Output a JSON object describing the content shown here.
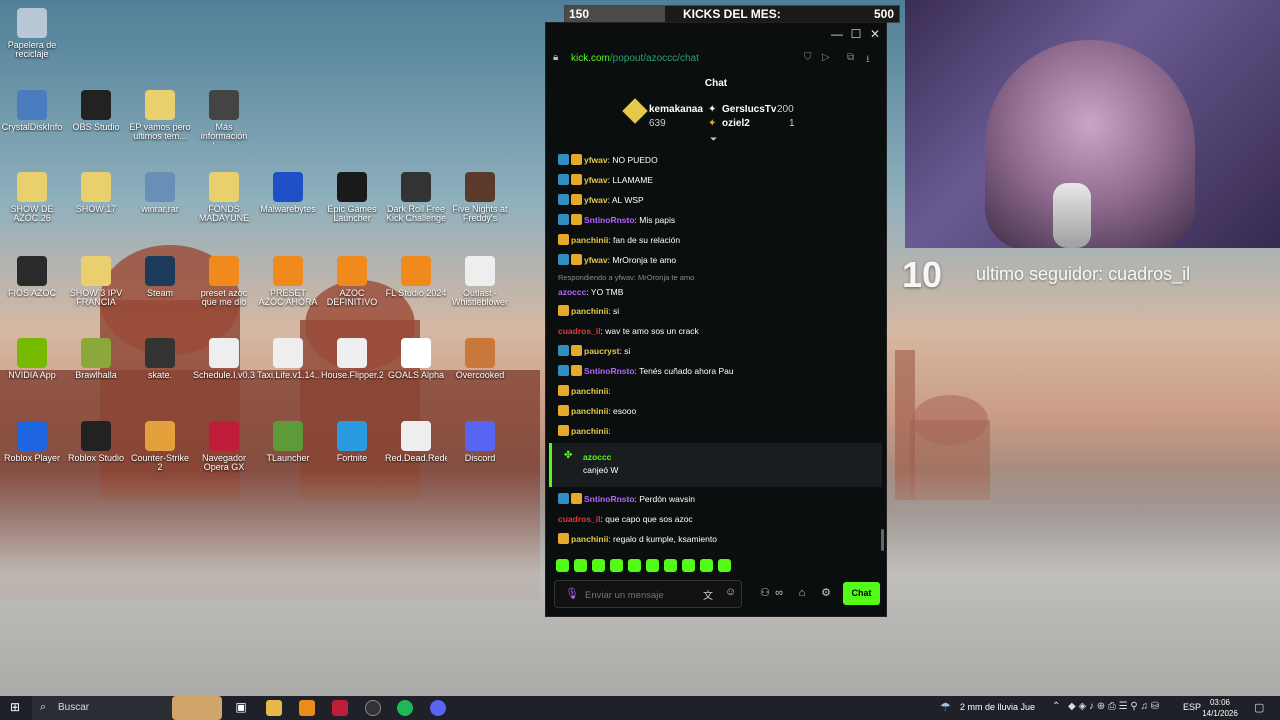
{
  "desktop": {
    "icons": [
      {
        "label": "Papelera de reciclaje",
        "icon": "recycle-bin-icon",
        "color": "#b8c6d6"
      },
      {
        "label": "CrystalDiskInfo",
        "icon": "disk-icon",
        "color": "#4a7cc0"
      },
      {
        "label": "OBS Studio",
        "icon": "obs-icon",
        "color": "#222222"
      },
      {
        "label": "EP vamos pero ultimos tem...",
        "icon": "folder-icon",
        "color": "#e9cf6d"
      },
      {
        "label": "Más información sobre esta ima...",
        "icon": "camera-icon",
        "color": "#444444"
      },
      {
        "label": "SHOW DE AZOC 26",
        "icon": "folder-icon",
        "color": "#e9cf6d"
      },
      {
        "label": "SHOW 17",
        "icon": "folder-icon",
        "color": "#e9cf6d"
      },
      {
        "label": "winrar.rar",
        "icon": "archive-icon",
        "color": "#6a8fb6"
      },
      {
        "label": "FONDS MADAYUNE",
        "icon": "folder-icon",
        "color": "#e9cf6d"
      },
      {
        "label": "Malwarebytes",
        "icon": "malwarebytes-icon",
        "color": "#2050c8"
      },
      {
        "label": "Epic Games Launcher",
        "icon": "epic-icon",
        "color": "#1a1a1a"
      },
      {
        "label": "Dark Roll Free Kick Challenge",
        "icon": "ball-icon",
        "color": "#333333"
      },
      {
        "label": "Five Nights at Freddy's",
        "icon": "freddy-icon",
        "color": "#5a3a2a"
      },
      {
        "label": "FIOS AZOC",
        "icon": "folder-icon",
        "color": "#2a2a2a"
      },
      {
        "label": "SHOW 3 IPV FRANCIA",
        "icon": "folder-icon",
        "color": "#e9cf6d"
      },
      {
        "label": "Steam",
        "icon": "steam-icon",
        "color": "#1b3a5c"
      },
      {
        "label": "preset azoc que me dio gonza",
        "icon": "fl-icon",
        "color": "#f08a1c"
      },
      {
        "label": "PRESET AZOC AHORA SI",
        "icon": "fl-icon",
        "color": "#f08a1c"
      },
      {
        "label": "AZOC DEFINITIVO",
        "icon": "fl-icon",
        "color": "#f08a1c"
      },
      {
        "label": "FL Studio 2024",
        "icon": "fl-icon",
        "color": "#f08a1c"
      },
      {
        "label": "Outlast - Whistleblower",
        "icon": "file-icon",
        "color": "#eeeeee"
      },
      {
        "label": "NVIDIA App",
        "icon": "nvidia-icon",
        "color": "#76b900"
      },
      {
        "label": "Brawlhalla",
        "icon": "brawlhalla-icon",
        "color": "#8ba83a"
      },
      {
        "label": "skate.",
        "icon": "skate-icon",
        "color": "#333333"
      },
      {
        "label": "Schedule.I.v0.3...",
        "icon": "file-icon",
        "color": "#eeeeee"
      },
      {
        "label": "Taxi.Life.v1.14...",
        "icon": "file-icon",
        "color": "#eeeeee"
      },
      {
        "label": "House.Flipper.2...",
        "icon": "file-icon",
        "color": "#eeeeee"
      },
      {
        "label": "GOALS Alpha",
        "icon": "goals-icon",
        "color": "#ffffff"
      },
      {
        "label": "Overcooked",
        "icon": "overcooked-icon",
        "color": "#c9773a"
      },
      {
        "label": "Roblox Player",
        "icon": "roblox-icon",
        "color": "#1f64e0"
      },
      {
        "label": "Roblox Studio",
        "icon": "roblox-studio-icon",
        "color": "#222222"
      },
      {
        "label": "Counter-Strike 2",
        "icon": "cs2-icon",
        "color": "#e4a03a"
      },
      {
        "label": "Navegador Opera GX",
        "icon": "opera-icon",
        "color": "#c01d3a"
      },
      {
        "label": "TLauncher",
        "icon": "minecraft-icon",
        "color": "#5c9a3a"
      },
      {
        "label": "Fortnite",
        "icon": "fortnite-icon",
        "color": "#2b9be0"
      },
      {
        "label": "Red.Dead.Rede...",
        "icon": "file-icon",
        "color": "#eeeeee"
      },
      {
        "label": "Discord",
        "icon": "discord-icon",
        "color": "#5865f2"
      }
    ]
  },
  "kicks_bar": {
    "current": "150",
    "label": "KICKS DEL MES:",
    "goal": "500",
    "progress": 0.3
  },
  "chat": {
    "url_host": "kick.com",
    "url_path": "/popout/azoccc/chat",
    "title": "Chat",
    "leaders": [
      {
        "name": "kemakanaa",
        "count": "639",
        "color": "#e6c84a"
      },
      {
        "name": "GersIucsTv",
        "count": "200",
        "color": "#ffffff"
      },
      {
        "name": "oziel2",
        "count": "1",
        "color": "#e6c84a"
      }
    ],
    "messages": [
      {
        "badges": [
          "blue",
          "gold"
        ],
        "user": "yfwav",
        "color": "#e6c84a",
        "text": ": NO PUEDO"
      },
      {
        "badges": [
          "blue",
          "gold"
        ],
        "user": "yfwav",
        "color": "#e6c84a",
        "text": ": LLAMAME"
      },
      {
        "badges": [
          "blue",
          "gold"
        ],
        "user": "yfwav",
        "color": "#e6c84a",
        "text": ": AL WSP"
      },
      {
        "badges": [
          "blue",
          "gold"
        ],
        "user": "SntinoRnsto",
        "color": "#b365ff",
        "text": ": Mis papis"
      },
      {
        "badges": [
          "gold"
        ],
        "user": "panchinii",
        "color": "#e6c84a",
        "text": ": fan de su relación"
      },
      {
        "badges": [
          "blue",
          "gold"
        ],
        "user": "yfwav",
        "color": "#e6c84a",
        "text": ": MrOronja te amo"
      },
      {
        "badges": [],
        "user": "azoccc",
        "color": "#b365ff",
        "text": ": YO TMB"
      },
      {
        "badges": [
          "gold"
        ],
        "user": "panchinii",
        "color": "#e6c84a",
        "text": ": si"
      },
      {
        "badges": [],
        "user": "cuadros_il",
        "color": "#e03a3a",
        "text": ": wav te amo sos un crack"
      },
      {
        "badges": [
          "blue",
          "gold"
        ],
        "user": "paucryst",
        "color": "#e6c84a",
        "text": ": si"
      },
      {
        "badges": [
          "blue",
          "gold"
        ],
        "user": "SntinoRnsto",
        "color": "#b365ff",
        "text": ": Tenés cuñado ahora Pau"
      },
      {
        "badges": [
          "gold"
        ],
        "user": "panchinii",
        "color": "#e6c84a",
        "text": ":"
      },
      {
        "badges": [
          "gold"
        ],
        "user": "panchinii",
        "color": "#e6c84a",
        "text": ": esooo"
      },
      {
        "badges": [
          "gold"
        ],
        "user": "panchinii",
        "color": "#e6c84a",
        "text": ":"
      },
      {
        "badges": [
          "blue",
          "gold"
        ],
        "user": "SntinoRnsto",
        "color": "#b365ff",
        "text": ": Perdón wavsin"
      },
      {
        "badges": [],
        "user": "cuadros_il",
        "color": "#e03a3a",
        "text": ": que capo que sos azoc"
      },
      {
        "badges": [
          "gold"
        ],
        "user": "panchinii",
        "color": "#e6c84a",
        "text": ": regalo d kumple, ksamiento"
      }
    ],
    "reply_note": "Respondiendo a yfwav: MrOronja te amo",
    "redeem": {
      "user": "azoccc",
      "text": "canjeó W"
    },
    "input_placeholder": "Enviar un mensaje",
    "send_label": "Chat",
    "accent": "#53fc18"
  },
  "overlay": {
    "follow_count": "10",
    "last_follower": "ultimo seguidor: cuadros_il"
  },
  "taskbar": {
    "search_placeholder": "Buscar",
    "weather": "2 mm de lluvia Jue",
    "lang": "ESP",
    "time": "03:06",
    "date": "14/1/2026"
  }
}
